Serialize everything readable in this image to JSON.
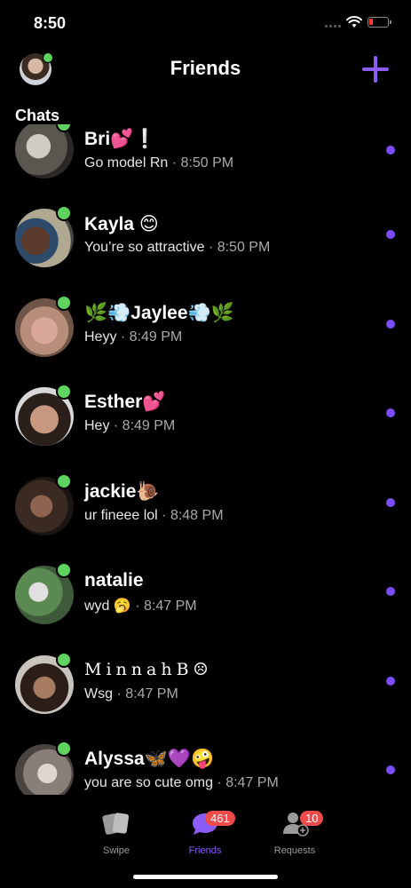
{
  "status": {
    "time": "8:50"
  },
  "header": {
    "title": "Friends"
  },
  "section": {
    "label": "Chats"
  },
  "chats": [
    {
      "name": "Bri💕❕",
      "message": "Go model Rn",
      "time": "8:50 PM",
      "avatar_color": "#5a5650"
    },
    {
      "name": "Kayla 😊",
      "message": "You’re so attractive",
      "time": "8:50 PM",
      "avatar_color": "#3a3a44"
    },
    {
      "name": "🌿💨Jaylee💨🌿",
      "message": "Heyy",
      "time": "8:49 PM",
      "avatar_color": "#b88d7a"
    },
    {
      "name": "Esther💕",
      "message": "Hey",
      "time": "8:49 PM",
      "avatar_color": "#7a5a4c"
    },
    {
      "name": "jackie🐌",
      "message": "ur fineee lol",
      "time": "8:48 PM",
      "avatar_color": "#3b2a22"
    },
    {
      "name": "natalie",
      "message": "wyd 🥱",
      "time": "8:47 PM",
      "avatar_color": "#3f5a3a"
    },
    {
      "name": "MinnahB☹",
      "message": "Wsg",
      "time": "8:47 PM",
      "avatar_color": "#6e5a52"
    },
    {
      "name": "Alyssa🦋💜🤪",
      "message": "you are so cute omg",
      "time": "8:47 PM",
      "avatar_color": "#8a7f78"
    }
  ],
  "tabs": [
    {
      "label": "Swipe",
      "icon": "cards-icon"
    },
    {
      "label": "Friends",
      "icon": "chat-bubble-icon",
      "badge": "461"
    },
    {
      "label": "Requests",
      "icon": "add-user-icon",
      "badge": "10"
    }
  ],
  "colors": {
    "accent": "#8b5cf6",
    "online": "#5fd35f",
    "badge": "#ef4b4b"
  }
}
